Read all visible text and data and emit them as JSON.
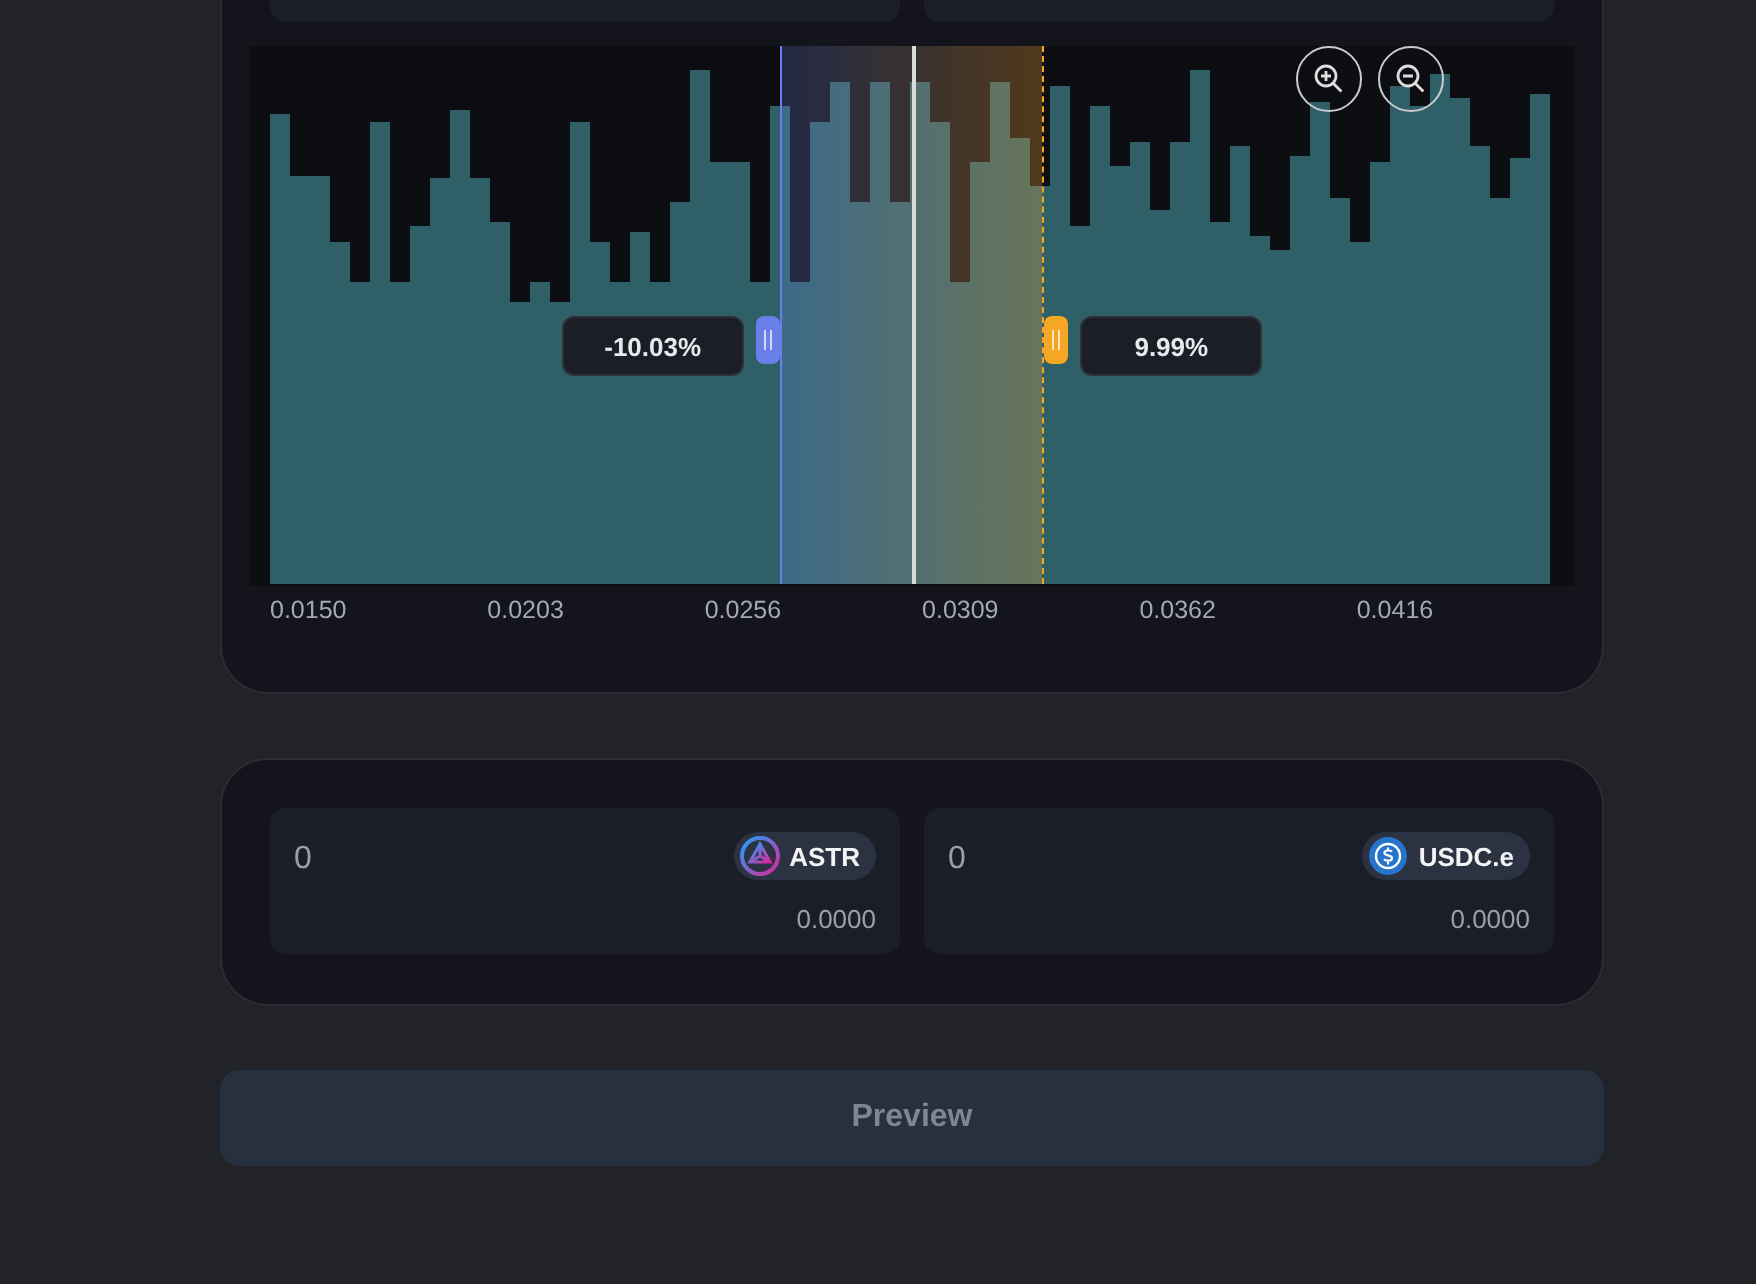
{
  "range": {
    "lower": {
      "level": 0.391,
      "label": "-10.03%"
    },
    "upper": {
      "level": 0.609,
      "label": "9.99%"
    },
    "current_price": {
      "level": 0.5
    }
  },
  "axis_labels": [
    "0.0150",
    "0.0203",
    "0.0256",
    "0.0309",
    "0.0362",
    "0.0416"
  ],
  "deposit": [
    {
      "kind": "astr",
      "placeholder": "0",
      "token": "ASTR",
      "balance": "0.0000"
    },
    {
      "kind": "usdc",
      "placeholder": "0",
      "token": "USDC.e",
      "balance": "0.0000"
    }
  ],
  "preview_button": {
    "label": "Preview",
    "disabled": true
  }
}
